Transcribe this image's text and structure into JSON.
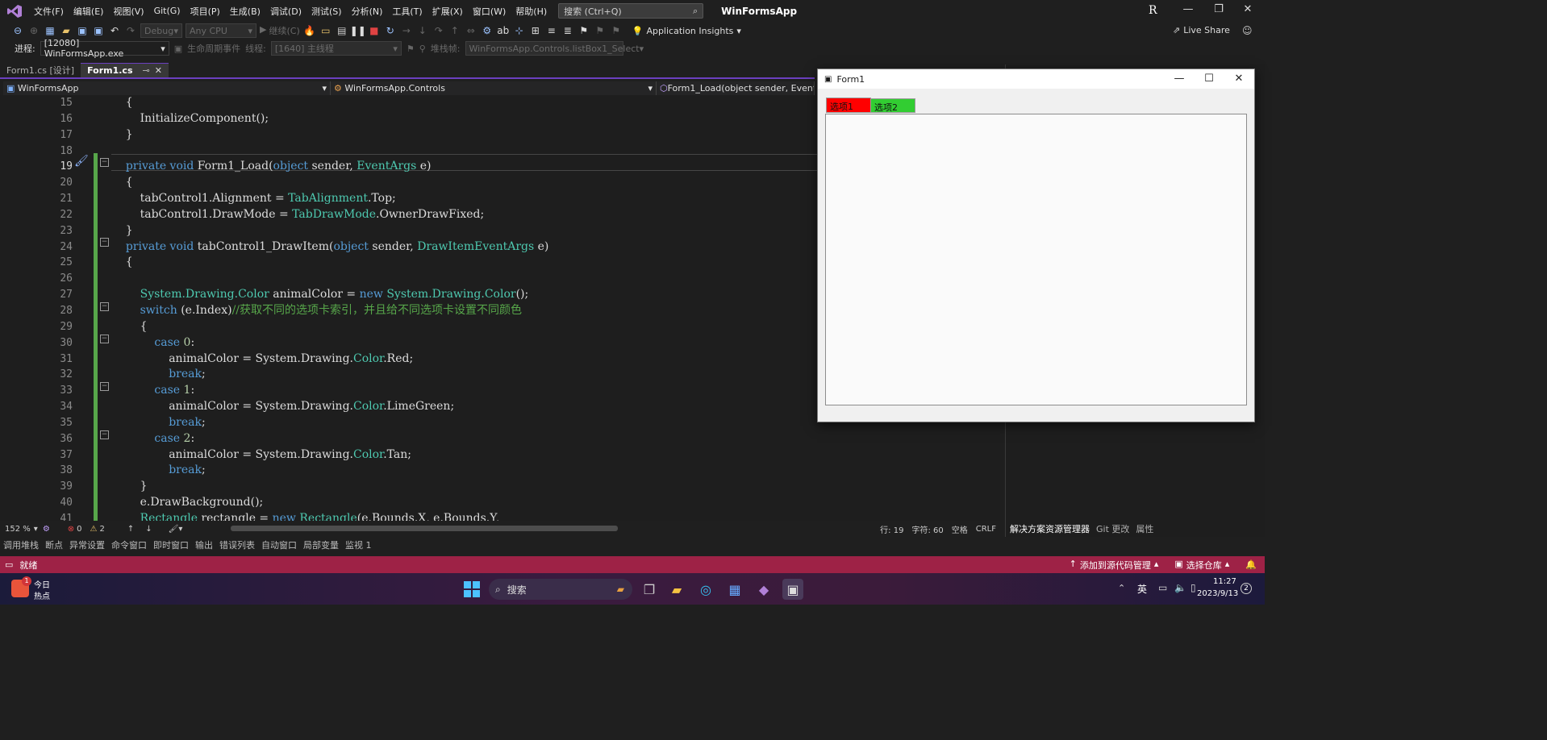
{
  "menubar": {
    "items": [
      "文件(F)",
      "编辑(E)",
      "视图(V)",
      "Git(G)",
      "项目(P)",
      "生成(B)",
      "调试(D)",
      "测试(S)",
      "分析(N)",
      "工具(T)",
      "扩展(X)",
      "窗口(W)",
      "帮助(H)"
    ],
    "search_placeholder": "搜索 (Ctrl+Q)",
    "app_title": "WinFormsApp",
    "user_initial": "R"
  },
  "toolbar": {
    "config": "Debug",
    "platform": "Any CPU",
    "continue_label": "继续(C)",
    "app_insights": "Application Insights",
    "live_share": "Live Share"
  },
  "toolbar2": {
    "process_label": "进程:",
    "process_value": "[12080] WinFormsApp.exe",
    "lifecycle_label": "生命周期事件",
    "thread_label": "线程:",
    "thread_value": "[1640] 主线程",
    "stack_label": "堆栈帧:",
    "stack_value": "WinFormsApp.Controls.listBox1_Select"
  },
  "doctabs": [
    {
      "label": "Form1.cs [设计]",
      "active": false
    },
    {
      "label": "Form1.cs",
      "active": true
    }
  ],
  "navbar": {
    "project": "WinFormsApp",
    "class": "WinFormsApp.Controls",
    "member": "Form1_Load(object sender, EventArgs e)"
  },
  "editor": {
    "line_numbers": [
      "15",
      "16",
      "17",
      "18",
      "19",
      "20",
      "21",
      "22",
      "23",
      "24",
      "25",
      "26",
      "27",
      "28",
      "29",
      "30",
      "31",
      "32",
      "33",
      "34",
      "35",
      "36",
      "37",
      "38",
      "39",
      "40",
      "41"
    ],
    "current_line": "19"
  },
  "editor_status": {
    "zoom": "152 %",
    "errors": "0",
    "warnings": "2",
    "line": "行: 19",
    "char": "字符: 60",
    "spaces": "空格",
    "eol": "CRLF"
  },
  "right_panel_tabs": [
    "解决方案资源管理器",
    "Git 更改",
    "属性"
  ],
  "toolwindow_tabs": [
    "调用堆栈",
    "断点",
    "异常设置",
    "命令窗口",
    "即时窗口",
    "输出",
    "错误列表",
    "自动窗口",
    "局部变量",
    "监视 1"
  ],
  "statusbar": {
    "ready": "就绪",
    "add_source": "添加到源代码管理",
    "select_repo": "选择仓库"
  },
  "taskbar": {
    "weather_title": "今日",
    "weather_sub": "热点",
    "weather_badge": "1",
    "search": "搜索",
    "ime": "英",
    "time": "11:27",
    "date": "2023/9/13",
    "notif_count": "2"
  },
  "form1": {
    "title": "Form1",
    "tabs": [
      {
        "label": "选项1",
        "color": "#ff0000"
      },
      {
        "label": "选项2",
        "color": "#32cd32"
      }
    ]
  },
  "colors": {
    "accent_purple": "#6b3fbf",
    "status_bar": "#9e2246",
    "change_bar": "#57a64a"
  }
}
